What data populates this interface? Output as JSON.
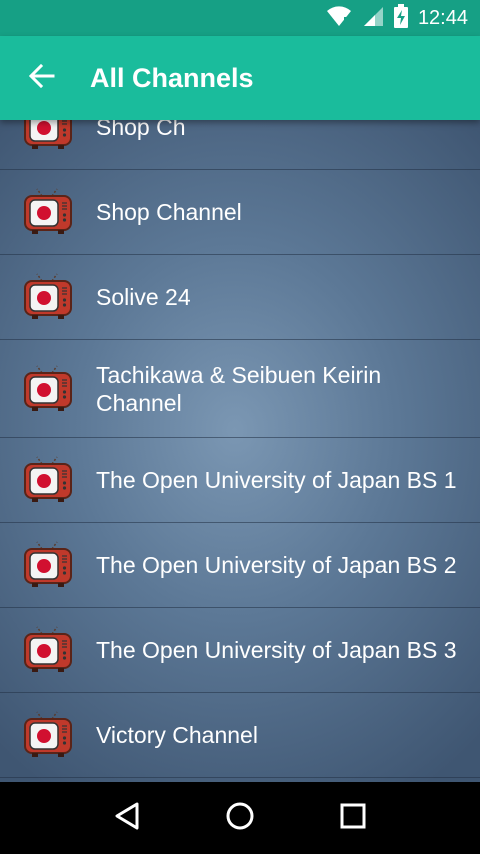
{
  "status_bar": {
    "time": "12:44",
    "icons": [
      "wifi-icon",
      "signal-icon",
      "battery-charging-icon"
    ]
  },
  "app_bar": {
    "title": "All Channels",
    "back_icon": "arrow-back-icon"
  },
  "channels": [
    {
      "label": "Shop Ch"
    },
    {
      "label": "Shop Channel"
    },
    {
      "label": "Solive 24"
    },
    {
      "label": "Tachikawa & Seibuen Keirin Channel"
    },
    {
      "label": "The Open University of Japan BS 1"
    },
    {
      "label": "The Open University of Japan BS 2"
    },
    {
      "label": "The Open University of Japan BS 3"
    },
    {
      "label": "Victory Channel"
    }
  ],
  "nav_bar": {
    "icons": [
      "back-triangle-icon",
      "home-circle-icon",
      "recents-square-icon"
    ]
  },
  "colors": {
    "status_bar": "#16a085",
    "app_bar": "#1abc9c",
    "list_bg": "#5c7896",
    "tv_body": "#c0392b",
    "flag_red": "#d11030"
  }
}
